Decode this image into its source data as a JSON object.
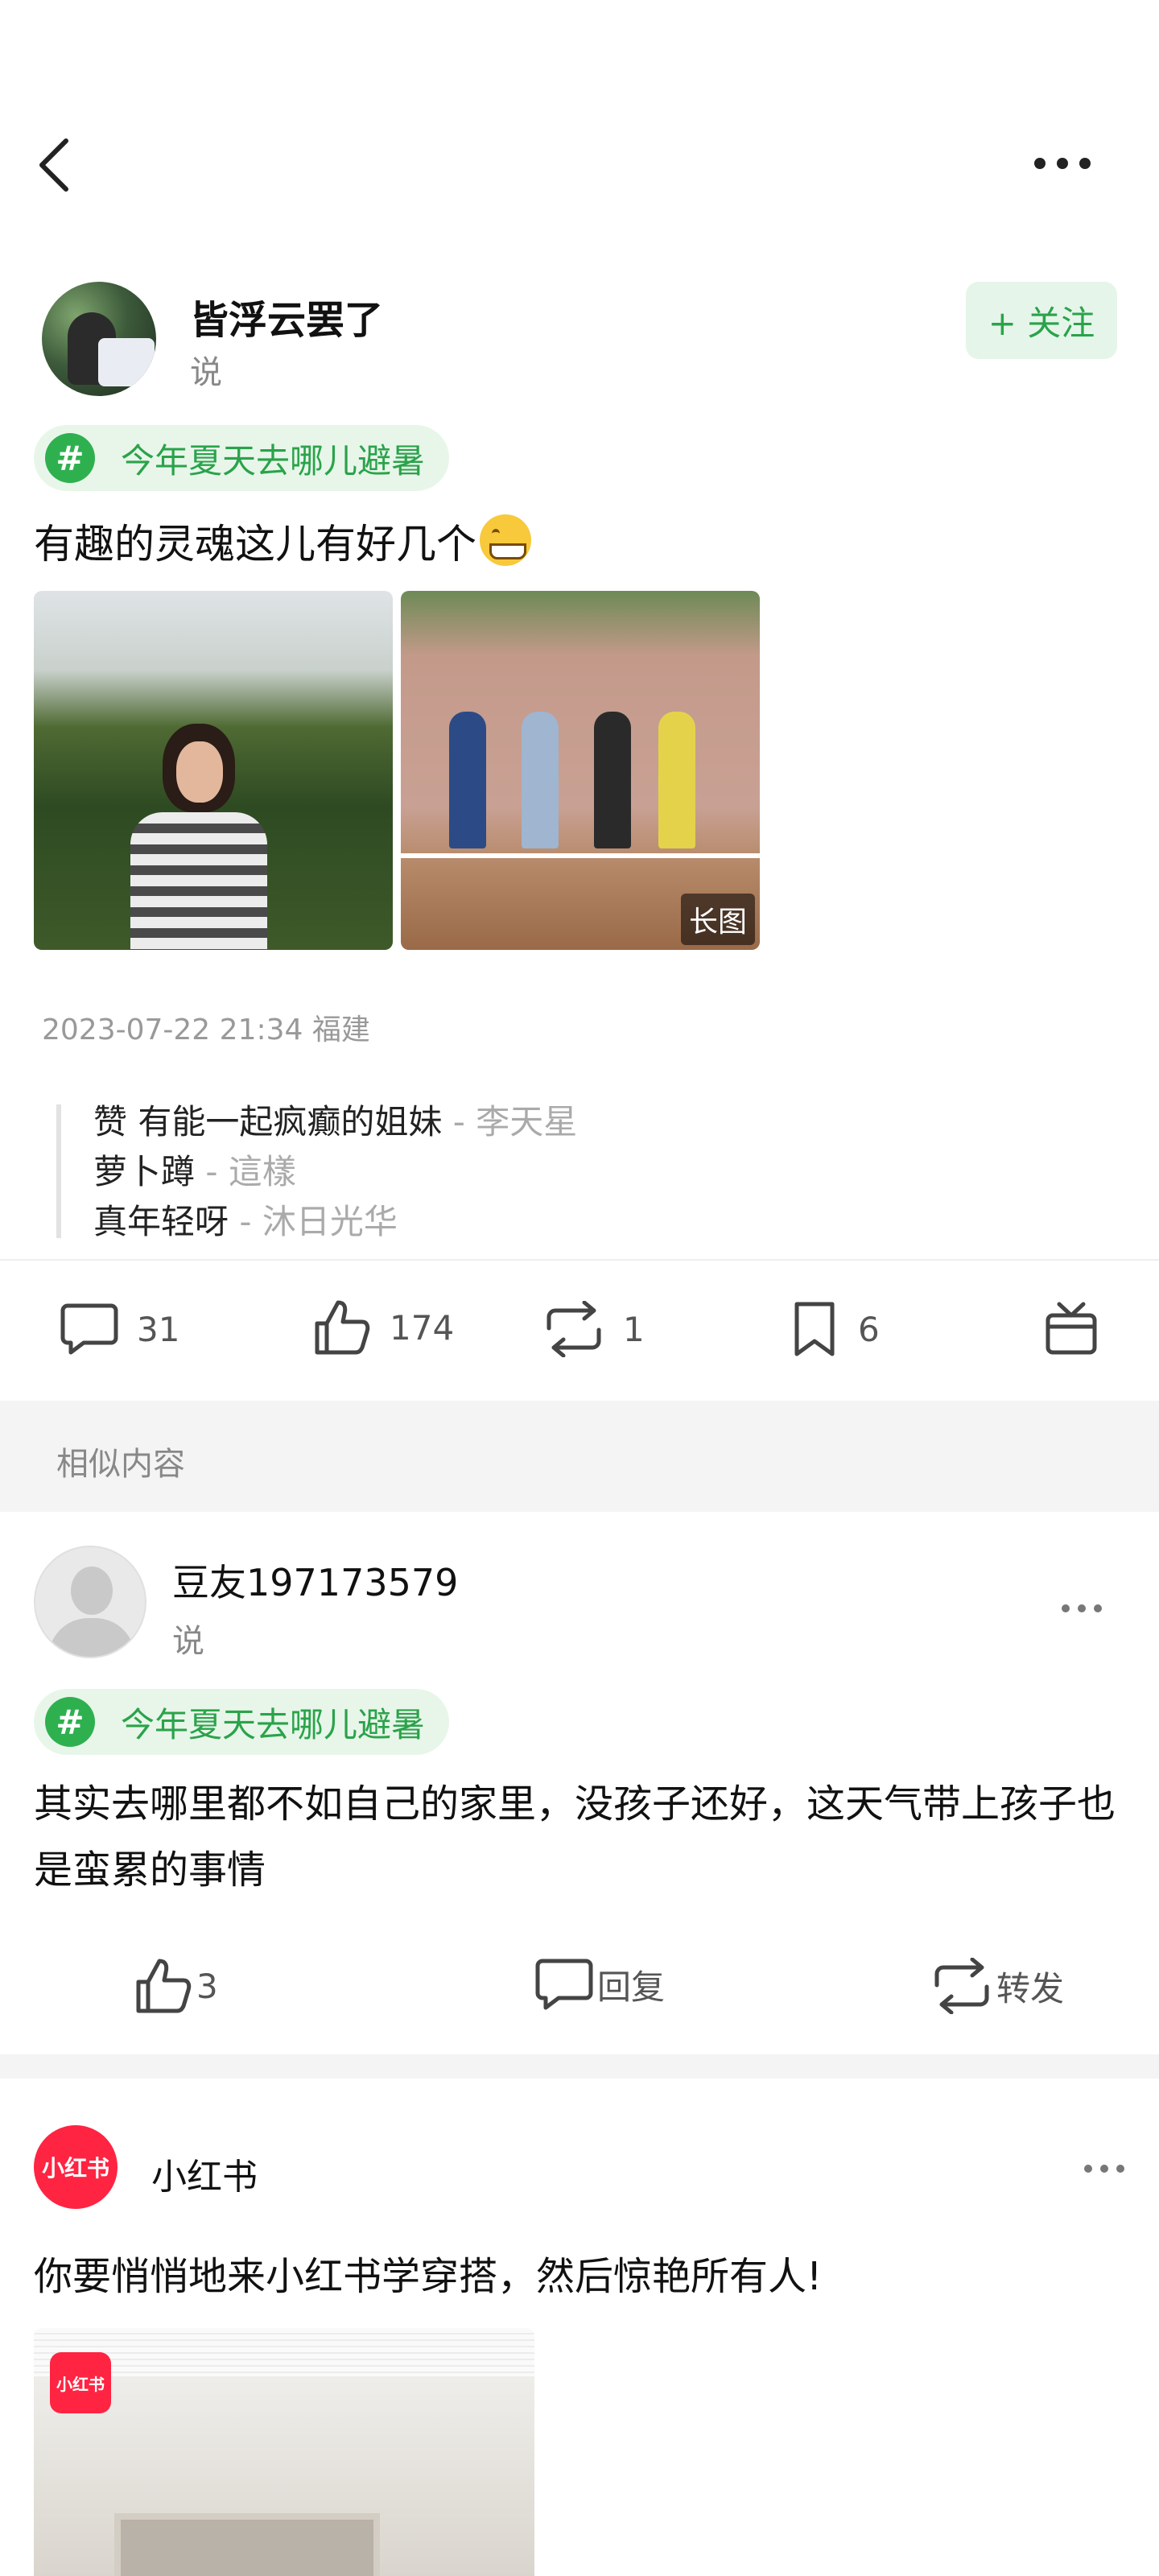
{
  "nav": {
    "back_icon": "back-icon",
    "more_icon": "more-icon"
  },
  "post": {
    "author": "皆浮云罢了",
    "action": "说",
    "follow_label": "+ 关注",
    "topic": "今年夏天去哪儿避暑",
    "topic_icon": "#",
    "text": "有趣的灵魂这儿有好几个",
    "image_badge": "长图",
    "meta": "2023-07-22 21:34 福建",
    "quotes": [
      {
        "text": "赞 有能一起疯癫的姐妹",
        "by": " - 李天星"
      },
      {
        "text": "萝卜蹲",
        "by": " - 這樣"
      },
      {
        "text": "真年轻呀",
        "by": " - 沐日光华"
      }
    ],
    "stats": {
      "comments": "31",
      "likes": "174",
      "reposts": "1",
      "bookmarks": "6"
    }
  },
  "similar": {
    "title": "相似内容",
    "items": [
      {
        "author": "豆友197173579",
        "action": "说",
        "topic": "今年夏天去哪儿避暑",
        "topic_icon": "#",
        "text": "其实去哪里都不如自己的家里，没孩子还好，这天气带上孩子也是蛮累的事情",
        "likes": "3",
        "reply_label": "回复",
        "repost_label": "转发"
      },
      {
        "author": "小红书",
        "logo_text": "小红书",
        "text": "你要悄悄地来小红书学穿搭，然后惊艳所有人!"
      }
    ]
  },
  "colors": {
    "accent": "#2aa34a",
    "accent_bg": "#e8f6ea",
    "brand_red": "#ff2442"
  }
}
